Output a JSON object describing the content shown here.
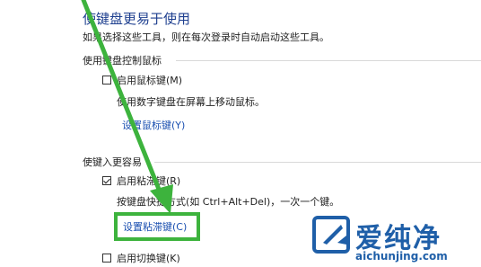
{
  "page": {
    "title": "使键盘更易于使用",
    "subtitle": "如果选择这些工具，则在每次登录时自动启动这些工具。"
  },
  "mouse_keys_section": {
    "header": "使用键盘控制鼠标",
    "option_label": "启用鼠标键(M)",
    "option_checked": false,
    "description": "使用数字键盘在屏幕上移动鼠标。",
    "settings_link": "设置鼠标键(Y)"
  },
  "typing_section": {
    "header": "使键入更容易",
    "sticky_keys": {
      "option_label": "启用粘滞键(R)",
      "option_checked": true,
      "description": "按键盘快捷方式(如 Ctrl+Alt+Del)，一次一个键。",
      "settings_link": "设置粘滞键(C)"
    },
    "toggle_keys": {
      "option_label": "启用切换键(K)",
      "option_checked": false
    }
  },
  "watermark": {
    "text": "爱纯净",
    "url": "aichunjing.com"
  },
  "colors": {
    "title": "#1e3f8f",
    "link": "#1a4fb0",
    "annotation_green": "#3db33d",
    "watermark_blue": "#1f5fa8"
  }
}
